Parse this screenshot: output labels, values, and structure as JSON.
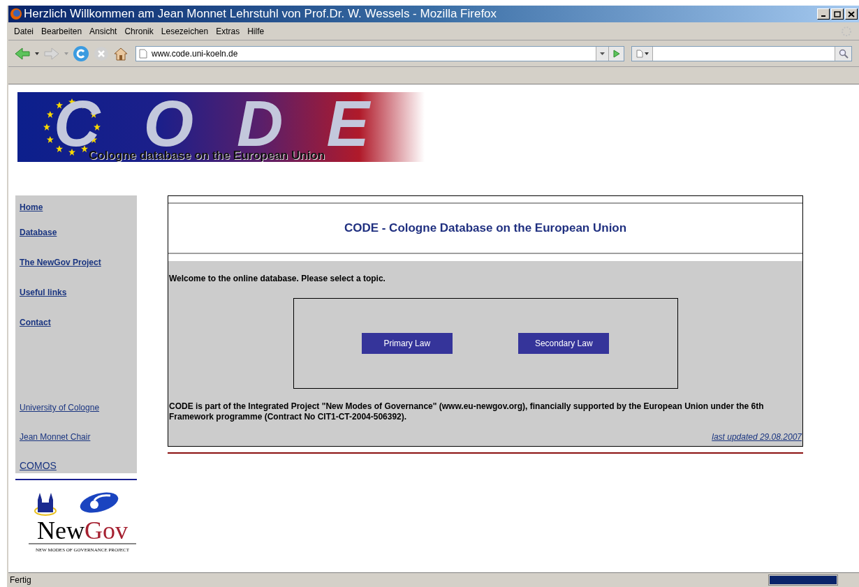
{
  "window": {
    "title": "Herzlich Willkommen am Jean Monnet Lehrstuhl von Prof.Dr. W. Wessels - Mozilla Firefox"
  },
  "menu": [
    "Datei",
    "Bearbeiten",
    "Ansicht",
    "Chronik",
    "Lesezeichen",
    "Extras",
    "Hilfe"
  ],
  "address_bar": {
    "value": "www.code.uni-koeln.de"
  },
  "page": {
    "banner": {
      "letters": [
        "C",
        "O",
        "D",
        "E"
      ],
      "subtitle": "Cologne database on the European Union"
    },
    "sidebar": {
      "main_links": [
        "Home",
        "Database",
        "The NewGov Project",
        "Useful links",
        "Contact"
      ],
      "other_links": [
        "University of Cologne",
        "Jean Monnet Chair",
        "COMOS"
      ]
    },
    "newgov_logo": {
      "name_part1": "New",
      "name_part2": "Gov",
      "tagline": "NEW MODES OF GOVERNANCE PROJECT"
    },
    "heading": "CODE - Cologne Database on the European Union",
    "welcome": "Welcome to the online database. Please select a topic.",
    "buttons": [
      "Primary Law",
      "Secondary Law"
    ],
    "info": "CODE is part of the Integrated Project \"New Modes of Governance\" (www.eu-newgov.org), financially supported by the European Union under the 6th Framework programme (Contract No CIT1-CT-2004-506392).",
    "last_updated": "last updated 29.08.2007"
  },
  "status_bar": {
    "text": "Fertig",
    "progress": {
      "level": 1
    }
  }
}
